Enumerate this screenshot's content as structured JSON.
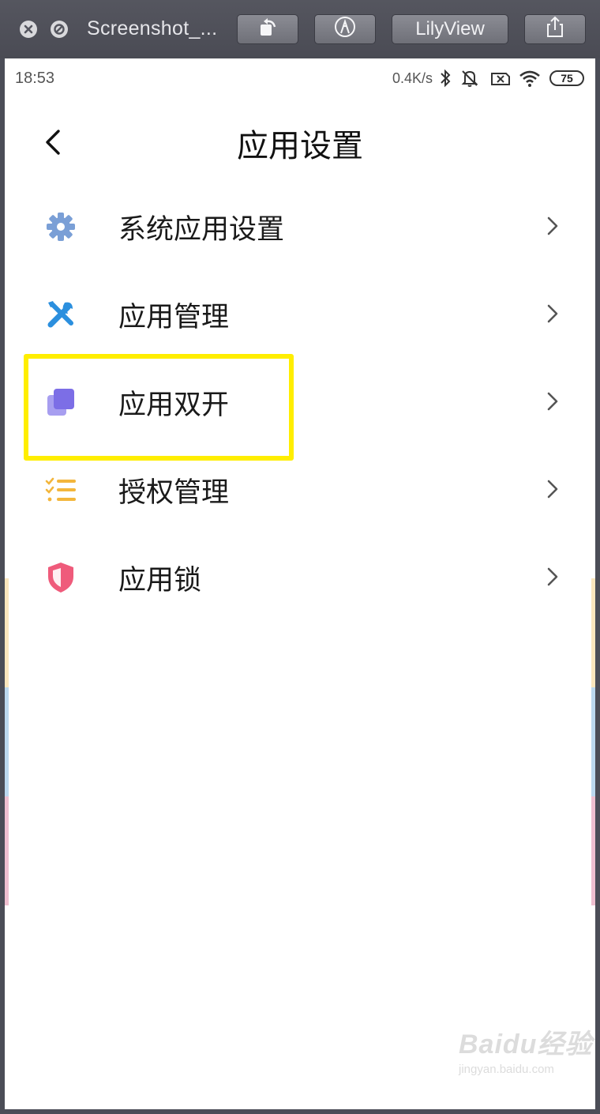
{
  "toolbar": {
    "title": "Screenshot_...",
    "lilyview_label": "LilyView"
  },
  "statusbar": {
    "time": "18:53",
    "net_speed": "0.4K/s",
    "battery": "75"
  },
  "header": {
    "title": "应用设置"
  },
  "menu": {
    "items": [
      {
        "label": "系统应用设置",
        "icon": "gear-icon",
        "color": "#7a9fd6"
      },
      {
        "label": "应用管理",
        "icon": "tools-icon",
        "color": "#2b8fde"
      },
      {
        "label": "应用双开",
        "icon": "dual-app-icon",
        "color": "#7c6ee6"
      },
      {
        "label": "授权管理",
        "icon": "checklist-icon",
        "color": "#f3b63c"
      },
      {
        "label": "应用锁",
        "icon": "shield-icon",
        "color": "#ef5b7b"
      }
    ]
  },
  "highlight": {
    "color": "#ffee00"
  },
  "watermark": {
    "brand": "Baidu经验",
    "url": "jingyan.baidu.com"
  }
}
